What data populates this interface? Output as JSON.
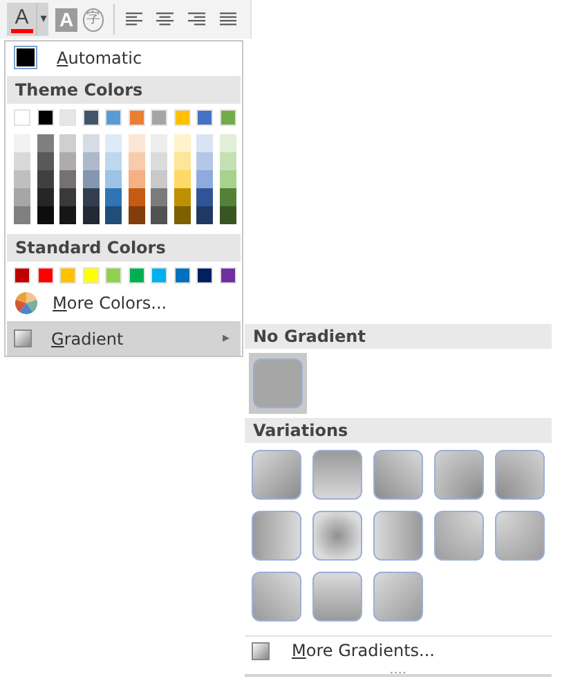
{
  "toolbar": {
    "font_color": {
      "glyph": "A",
      "color": "#ff0000"
    },
    "caret": "▾",
    "shading": {
      "glyph": "A"
    },
    "enclose": {
      "glyph": "字"
    }
  },
  "color_menu": {
    "automatic": {
      "label": "Automatic",
      "color": "#000000"
    },
    "theme_header": "Theme Colors",
    "theme_colors": [
      {
        "color": "#ffffff",
        "shades": [
          {
            "color": "#f2f2f2"
          },
          {
            "color": "#d9d9d9"
          },
          {
            "color": "#bfbfbf"
          },
          {
            "color": "#a6a6a6"
          },
          {
            "color": "#808080"
          }
        ]
      },
      {
        "color": "#000000",
        "shades": [
          {
            "color": "#7f7f7f"
          },
          {
            "color": "#595959"
          },
          {
            "color": "#404040"
          },
          {
            "color": "#262626"
          },
          {
            "color": "#0d0d0d"
          }
        ]
      },
      {
        "color": "#e7e6e6",
        "shades": [
          {
            "color": "#d0cece"
          },
          {
            "color": "#aeabab"
          },
          {
            "color": "#757171"
          },
          {
            "color": "#3a3838"
          },
          {
            "color": "#171616"
          }
        ]
      },
      {
        "color": "#44546a",
        "shades": [
          {
            "color": "#d6dce4"
          },
          {
            "color": "#adb9ca"
          },
          {
            "color": "#8496b0"
          },
          {
            "color": "#333f4f"
          },
          {
            "color": "#222a35"
          }
        ]
      },
      {
        "color": "#5b9bd5",
        "shades": [
          {
            "color": "#deebf6"
          },
          {
            "color": "#bdd7ee"
          },
          {
            "color": "#9dc3e6"
          },
          {
            "color": "#2e75b5"
          },
          {
            "color": "#1f4e79"
          }
        ]
      },
      {
        "color": "#ed7d31",
        "shades": [
          {
            "color": "#fbe5d5"
          },
          {
            "color": "#f7cbac"
          },
          {
            "color": "#f4b183"
          },
          {
            "color": "#c55a11"
          },
          {
            "color": "#833c0b"
          }
        ]
      },
      {
        "color": "#a5a5a5",
        "shades": [
          {
            "color": "#ededed"
          },
          {
            "color": "#dbdbdb"
          },
          {
            "color": "#c9c9c9"
          },
          {
            "color": "#7b7b7b"
          },
          {
            "color": "#525252"
          }
        ]
      },
      {
        "color": "#ffc000",
        "shades": [
          {
            "color": "#fff2cc"
          },
          {
            "color": "#fee599"
          },
          {
            "color": "#ffd966"
          },
          {
            "color": "#bf9000"
          },
          {
            "color": "#7f6000"
          }
        ]
      },
      {
        "color": "#4472c4",
        "shades": [
          {
            "color": "#dae3f3"
          },
          {
            "color": "#b4c7e7"
          },
          {
            "color": "#8faadc"
          },
          {
            "color": "#2f5597"
          },
          {
            "color": "#203864"
          }
        ]
      },
      {
        "color": "#70ad47",
        "shades": [
          {
            "color": "#e2efd9"
          },
          {
            "color": "#c5e0b3"
          },
          {
            "color": "#a9d18e"
          },
          {
            "color": "#538135"
          },
          {
            "color": "#375623"
          }
        ]
      }
    ],
    "standard_header": "Standard Colors",
    "standard_colors": [
      {
        "color": "#c00000"
      },
      {
        "color": "#ff0000"
      },
      {
        "color": "#ffc000"
      },
      {
        "color": "#ffff00"
      },
      {
        "color": "#92d050"
      },
      {
        "color": "#00b050"
      },
      {
        "color": "#00b0f0"
      },
      {
        "color": "#0070c0"
      },
      {
        "color": "#002060"
      },
      {
        "color": "#7030a0"
      }
    ],
    "more_colors": {
      "label": "More Colors..."
    },
    "gradient": {
      "label": "Gradient",
      "expanded": true,
      "arrow": "▸"
    }
  },
  "gradient_menu": {
    "no_gradient_header": "No Gradient",
    "no_gradient": {
      "selected": true
    },
    "variations_header": "Variations",
    "variations": [
      {
        "kind": "diagdown",
        "selected": false
      },
      {
        "kind": "down",
        "selected": false
      },
      {
        "kind": "diagleft",
        "selected": false
      },
      {
        "kind": "frombottomright",
        "selected": false
      },
      {
        "kind": "frombottomleft",
        "selected": false
      },
      {
        "kind": "right",
        "selected": false
      },
      {
        "kind": "center",
        "selected": false
      },
      {
        "kind": "left",
        "selected": false
      },
      {
        "kind": "fromtopright",
        "selected": false
      },
      {
        "kind": "fromtopleft",
        "selected": false
      },
      {
        "kind": "diagup",
        "selected": false
      },
      {
        "kind": "up",
        "selected": false
      },
      {
        "kind": "diagupleft",
        "selected": false
      }
    ],
    "more_gradients": {
      "label": "More Gradients..."
    }
  }
}
